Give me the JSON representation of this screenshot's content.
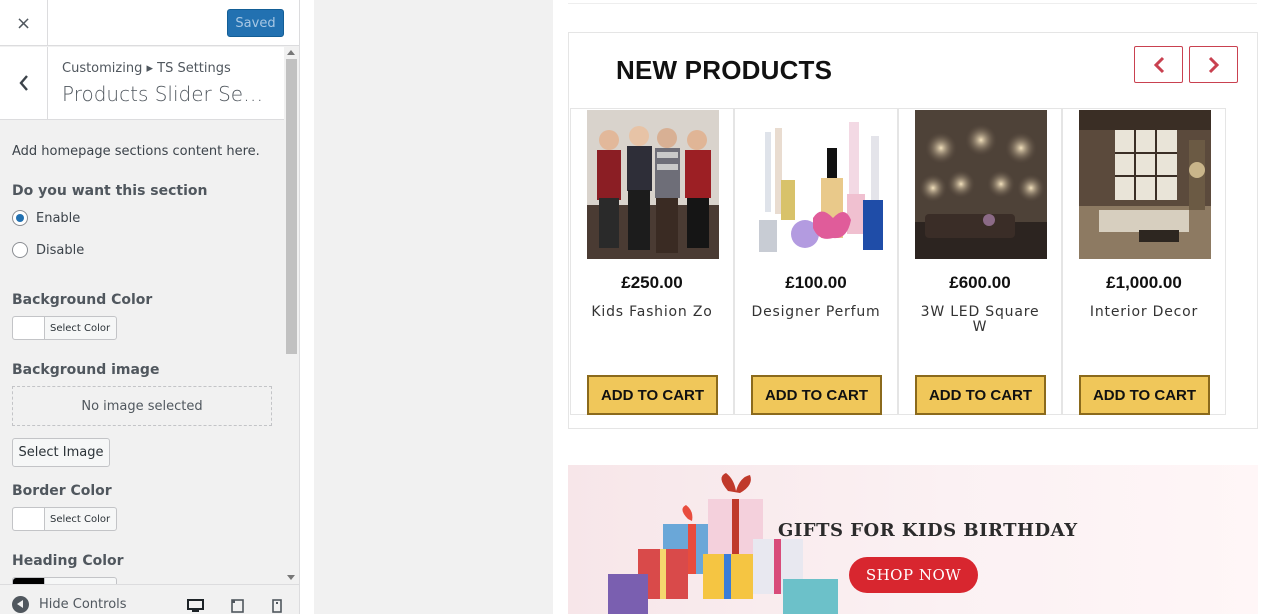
{
  "customizer": {
    "saved_label": "Saved",
    "close_label": "×",
    "breadcrumb": "Customizing ▸ TS Settings",
    "section_title": "Products Slider Secti…",
    "description": "Add homepage sections content here.",
    "section_toggle": {
      "title": "Do you want this section",
      "options": [
        "Enable",
        "Disable"
      ],
      "selected": "Enable"
    },
    "background_color": {
      "title": "Background Color",
      "button": "Select Color",
      "value": "#ffffff"
    },
    "background_image": {
      "title": "Background image",
      "empty_text": "No image selected",
      "button": "Select Image"
    },
    "border_color": {
      "title": "Border Color",
      "button": "Select Color",
      "value": "#ffffff"
    },
    "heading_color": {
      "title": "Heading Color",
      "value": "#000000"
    },
    "footer": {
      "hide_controls": "Hide Controls"
    },
    "accent": "#2271b1"
  },
  "preview": {
    "products_heading": "NEW PRODUCTS",
    "products": [
      {
        "price": "£250.00",
        "name": "Kids Fashion Zo",
        "cart": "ADD TO CART",
        "image": "kids-fashion-photo"
      },
      {
        "price": "£100.00",
        "name": "Designer Perfum",
        "cart": "ADD TO CART",
        "image": "perfume-bottles-photo"
      },
      {
        "price": "£600.00",
        "name": "3W LED Square W",
        "cart": "ADD TO CART",
        "image": "wall-lights-photo"
      },
      {
        "price": "£1,000.00",
        "name": "Interior Decor",
        "cart": "ADD TO CART",
        "image": "living-room-photo"
      }
    ],
    "banner": {
      "title": "GIFTS FOR KIDS BIRTHDAY",
      "button": "SHOP NOW"
    },
    "colors": {
      "nav_border": "#c94150",
      "cart_bg": "#f0c75a",
      "shop_now_bg": "#d8262f"
    }
  }
}
